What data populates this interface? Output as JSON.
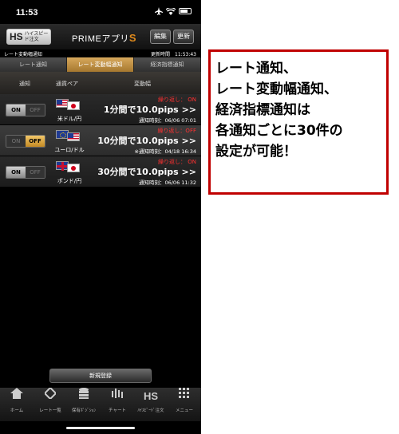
{
  "status_bar": {
    "time": "11:53"
  },
  "app": {
    "logo_text": "HS",
    "logo_subtext": "ハイスピード注文",
    "title_prefix": "PRIMEアプリ",
    "title_suffix": "S",
    "edit_button": "編集",
    "refresh_button": "更新"
  },
  "subheader": {
    "screen_name": "レート変動幅通知",
    "updated": "更新時間　11:53:43"
  },
  "tabs": [
    {
      "label": "レート通知",
      "active": false
    },
    {
      "label": "レート変動幅通知",
      "active": true
    },
    {
      "label": "経済指標通知",
      "active": false
    }
  ],
  "columns": {
    "notify": "通知",
    "pair": "通貨ペア",
    "range": "変動幅"
  },
  "rows": [
    {
      "on": "ON",
      "off": "OFF",
      "state": "on",
      "pair": "米ドル/円",
      "flags": [
        "us",
        "jp"
      ],
      "repeat": "繰り返し： ON",
      "rate": "1分間で10.0pips >>",
      "notify_time": "通知時刻：06/06 07:01"
    },
    {
      "on": "ON",
      "off": "OFF",
      "state": "off",
      "pair": "ユーロ/ドル",
      "flags": [
        "eu",
        "us"
      ],
      "repeat": "繰り返し：OFF",
      "rate": "10分間で10.0pips >>",
      "notify_time": "※通知時刻：04/18 16:34"
    },
    {
      "on": "ON",
      "off": "OFF",
      "state": "on",
      "pair": "ポンド/円",
      "flags": [
        "gb",
        "jp"
      ],
      "repeat": "繰り返し： ON",
      "rate": "30分間で10.0pips >>",
      "notify_time": "通知時刻：06/06 11:32"
    }
  ],
  "new_button": "新規登録",
  "bottom_nav": [
    {
      "icon": "home-icon",
      "label": "ホーム"
    },
    {
      "icon": "rate-list-icon",
      "label": "レート一覧"
    },
    {
      "icon": "position-icon",
      "label": "保有ﾎﾟｼﾞｼｮﾝ"
    },
    {
      "icon": "chart-icon",
      "label": "チャート"
    },
    {
      "icon": "hs-icon",
      "label": "ﾊｲｽﾋﾟｰﾄﾞ注文"
    },
    {
      "icon": "menu-icon",
      "label": "メニュー"
    }
  ],
  "callout": {
    "lines": [
      "レート通知、",
      "レート変動幅通知、",
      "経済指標通知は",
      "各通知ごとに30件の",
      "設定が可能！"
    ]
  },
  "colors": {
    "accent": "#d7a85c",
    "alert": "#ff3030",
    "callout_border": "#c00000"
  }
}
